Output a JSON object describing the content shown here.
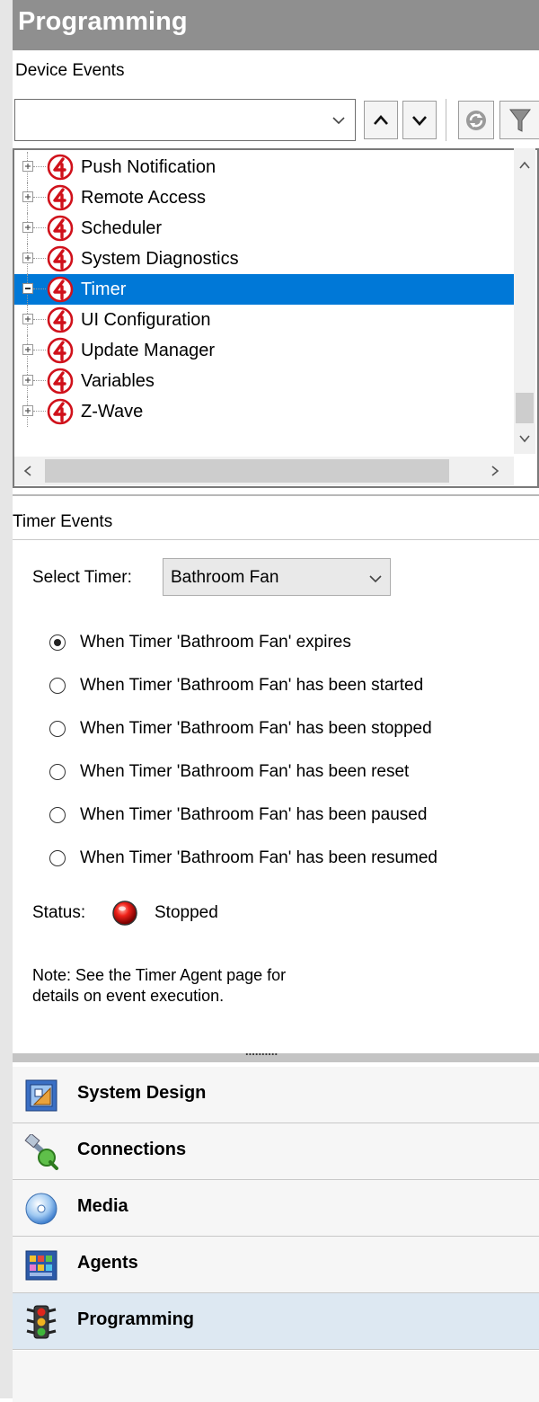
{
  "header": {
    "title": "Programming"
  },
  "device_events": {
    "label": "Device Events",
    "search_value": "",
    "tree_items": [
      {
        "label": "Push Notification",
        "expanded": false,
        "selected": false
      },
      {
        "label": "Remote Access",
        "expanded": false,
        "selected": false
      },
      {
        "label": "Scheduler",
        "expanded": false,
        "selected": false
      },
      {
        "label": "System Diagnostics",
        "expanded": false,
        "selected": false
      },
      {
        "label": "Timer",
        "expanded": true,
        "selected": true
      },
      {
        "label": "UI Configuration",
        "expanded": false,
        "selected": false
      },
      {
        "label": "Update Manager",
        "expanded": false,
        "selected": false
      },
      {
        "label": "Variables",
        "expanded": false,
        "selected": false
      },
      {
        "label": "Z-Wave",
        "expanded": false,
        "selected": false
      }
    ]
  },
  "timer_events": {
    "label": "Timer Events",
    "select_label": "Select Timer:",
    "selected_timer": "Bathroom Fan",
    "options": [
      {
        "label": "When Timer 'Bathroom Fan' expires",
        "checked": true
      },
      {
        "label": "When Timer 'Bathroom Fan' has been started",
        "checked": false
      },
      {
        "label": "When Timer 'Bathroom Fan' has been stopped",
        "checked": false
      },
      {
        "label": "When Timer 'Bathroom Fan' has been reset",
        "checked": false
      },
      {
        "label": "When Timer 'Bathroom Fan' has been paused",
        "checked": false
      },
      {
        "label": "When Timer 'Bathroom Fan' has been resumed",
        "checked": false
      }
    ],
    "status_label": "Status:",
    "status_value": "Stopped",
    "note_line1": "Note: See the Timer Agent page for",
    "note_line2": "details on event execution."
  },
  "splitter_grip": "..........",
  "nav": [
    {
      "label": "System Design",
      "icon": "system-design-icon",
      "active": false
    },
    {
      "label": "Connections",
      "icon": "connections-icon",
      "active": false
    },
    {
      "label": "Media",
      "icon": "media-icon",
      "active": false
    },
    {
      "label": "Agents",
      "icon": "agents-icon",
      "active": false
    },
    {
      "label": "Programming",
      "icon": "programming-icon",
      "active": true
    }
  ],
  "colors": {
    "selection": "#0078d7",
    "header": "#8f8f8f",
    "control4_red": "#d0111b"
  }
}
